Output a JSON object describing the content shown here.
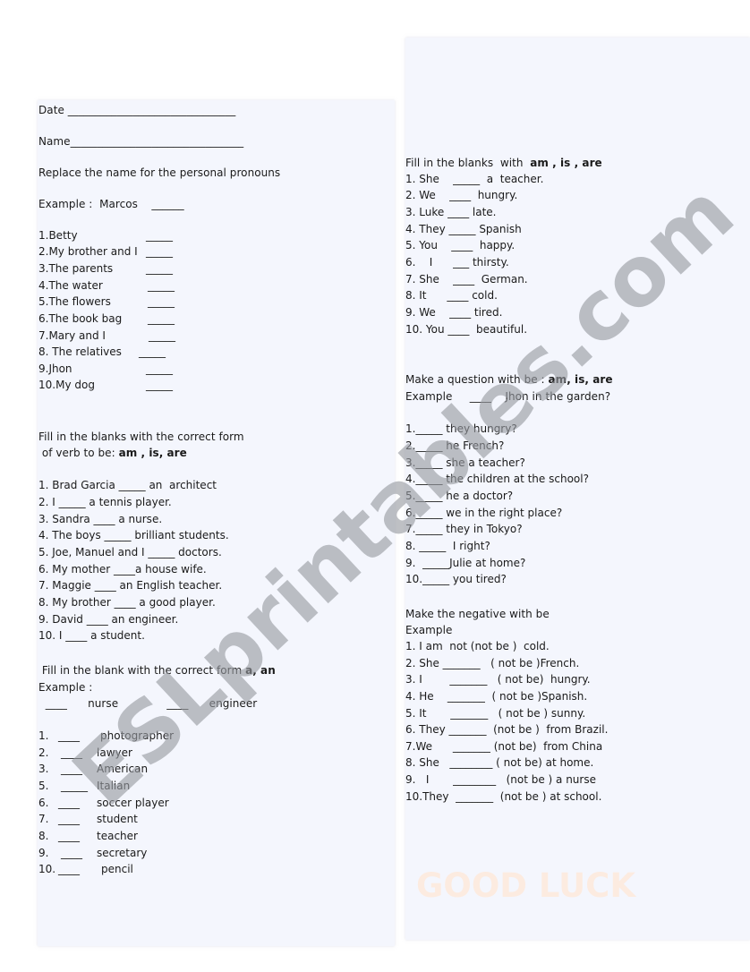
{
  "left": {
    "date_label": "Date _______________________________",
    "name_label": "Name________________________________",
    "section1": {
      "title": "Replace the name for the personal pronouns",
      "example": "Example :  Marcos    ______",
      "items": [
        {
          "text": "1.Betty",
          "blank": "_____"
        },
        {
          "text": "2.My brother and I",
          "blank": "_____"
        },
        {
          "text": "3.The parents",
          "blank": "_____"
        },
        {
          "text": "4.The water",
          "blank": "_____"
        },
        {
          "text": "5.The flowers",
          "blank": "_____"
        },
        {
          "text": "6.The book bag",
          "blank": "_____"
        },
        {
          "text": "7.Mary and I",
          "blank": "_____"
        },
        {
          "text": "8. The relatives",
          "blank": "_____"
        },
        {
          "text": "9.Jhon",
          "blank": "_____"
        },
        {
          "text": "10.My dog",
          "blank": "_____"
        }
      ]
    },
    "section2": {
      "title_line1": "Fill in the blanks with the correct form",
      "title_line2": " of verb to be: ",
      "title_bold": "am , is, are",
      "items": [
        "1. Brad Garcia _____ an  architect",
        "2. I _____ a tennis player.",
        "3. Sandra ____ a nurse.",
        "4. The boys _____ brilliant students.",
        "5. Joe, Manuel and I _____ doctors.",
        "6. My mother ____a house wife.",
        "7. Maggie ____ an English teacher.",
        "8. My brother ____ a good player.",
        "9. David ____ an engineer.",
        "10. I ____ a student."
      ]
    },
    "section3": {
      "title": " Fill in the blank with the correct form ",
      "title_bold": "a, an",
      "example_label": "Example :",
      "example_line": "  ____      nurse              ____      engineer",
      "items": [
        {
          "num": "1.",
          "blank": "____",
          "word": "photographer"
        },
        {
          "num": "2.",
          "blank": "____",
          "word": "lawyer"
        },
        {
          "num": "3.",
          "blank": "____",
          "word": "American"
        },
        {
          "num": "5.",
          "blank": "_____",
          "word": "Italian"
        },
        {
          "num": "6.",
          "blank": "____",
          "word": "soccer player"
        },
        {
          "num": "7.",
          "blank": "____",
          "word": "student"
        },
        {
          "num": "8.",
          "blank": "____",
          "word": "teacher"
        },
        {
          "num": "9.",
          "blank": "____",
          "word": "secretary"
        },
        {
          "num": "10.",
          "blank": "____",
          "word": "pencil"
        }
      ]
    }
  },
  "right": {
    "section1": {
      "title": "Fill in the blanks  with  ",
      "title_bold": "am , is , are",
      "items": [
        "1. She    _____  a  teacher.",
        "2. We    ____  hungry.",
        "3. Luke ____ late.",
        "4. They _____ Spanish",
        "5. You    ____  happy.",
        "6.    I      ___ thirsty.",
        "7. She    ____  German.",
        "8. It      ____ cold.",
        "9. We    ____ tired.",
        "10. You ____  beautiful."
      ]
    },
    "section2": {
      "title": "Make a question with be : ",
      "title_bold": "am, is, are",
      "example": "Example     ____    Jhon in the garden?",
      "items": [
        "1._____ they hungry?",
        "2._____ he French?",
        "3._____ she a teacher?",
        "4._____ the children at the school?",
        "5._____ he a doctor?",
        "6._____ we in the right place?",
        "7._____ they in Tokyo?",
        "8. _____  I right?",
        "9.  _____Julie at home?",
        "10._____ you tired?"
      ]
    },
    "section3": {
      "title": "Make the negative with be",
      "example_label": "Example",
      "items": [
        "1. I am  not (not be )  cold.",
        "2. She _______   ( not be )French.",
        "3. I        _______   ( not be)  hungry.",
        "4. He    _______  ( not be )Spanish.",
        "5. It       _______   ( not be ) sunny.",
        "6. They _______  (not be )  from Brazil.",
        "7.We      _______ (not be)  from China",
        "8. She   ________ ( not be) at home.",
        "9.   I       ________   (not be ) a nurse",
        "10.They  _______  (not be ) at school."
      ]
    },
    "closing": "GOOD LUCK"
  },
  "watermark": "ESLprintables.com",
  "colors": {
    "panel_bg": "#f4f6fd",
    "text": "#1a1a1a",
    "watermark": "#9a9ca3",
    "good_luck": "#fcebe0"
  }
}
